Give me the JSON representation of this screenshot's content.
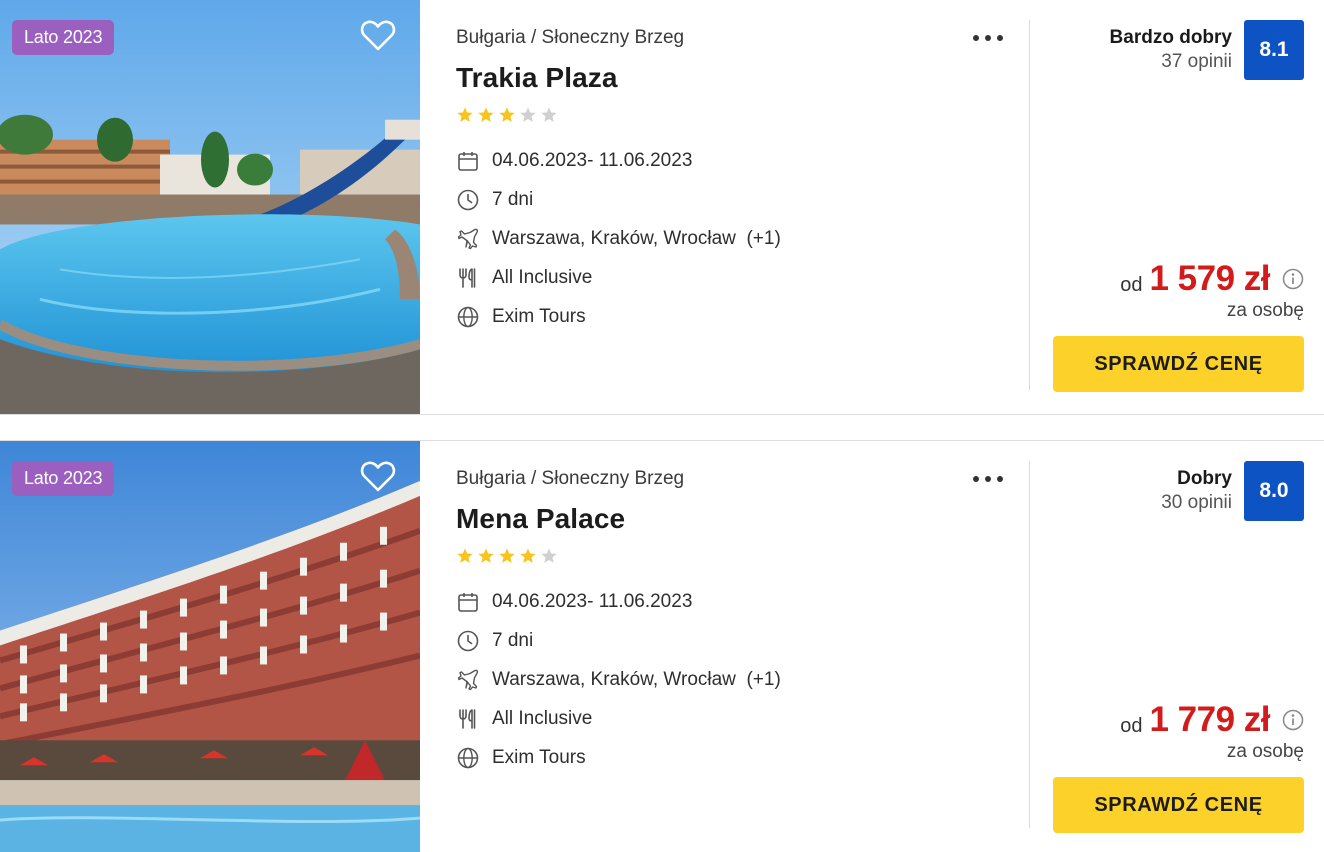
{
  "offers": [
    {
      "season_badge": "Lato 2023",
      "location": "Bułgaria / Słoneczny Brzeg",
      "hotel_name": "Trakia Plaza",
      "stars": 3,
      "features": {
        "dates": "04.06.2023- 11.06.2023",
        "duration": "7 dni",
        "departure": "Warszawa, Kraków, Wrocław  (+1)",
        "board": "All Inclusive",
        "operator": "Exim Tours"
      },
      "rating": {
        "label": "Bardzo dobry",
        "reviews": "37 opinii",
        "score": "8.1"
      },
      "price": {
        "prefix": "od",
        "value": "1 579 zł",
        "per_person": "za osobę"
      },
      "button_label": "SPRAWDŹ CENĘ"
    },
    {
      "season_badge": "Lato 2023",
      "location": "Bułgaria / Słoneczny Brzeg",
      "hotel_name": "Mena Palace",
      "stars": 4,
      "features": {
        "dates": "04.06.2023- 11.06.2023",
        "duration": "7 dni",
        "departure": "Warszawa, Kraków, Wrocław  (+1)",
        "board": "All Inclusive",
        "operator": "Exim Tours"
      },
      "rating": {
        "label": "Dobry",
        "reviews": "30 opinii",
        "score": "8.0"
      },
      "price": {
        "prefix": "od",
        "value": "1 779 zł",
        "per_person": "za osobę"
      },
      "button_label": "SPRAWDŹ CENĘ"
    }
  ],
  "icons": {
    "favorite": "heart-outline-icon",
    "more": "more-dots-icon",
    "star": "star-icon",
    "dates": "calendar-icon",
    "duration": "clock-icon",
    "departure": "plane-icon",
    "board": "cutlery-icon",
    "operator": "globe-icon",
    "price_info": "info-icon"
  },
  "colors": {
    "badge": "#9b5fc0",
    "score": "#0e53c4",
    "price": "#d21c1c",
    "button": "#fcd22a",
    "star_on": "#f8c41b",
    "star_off": "#d0d0d0"
  }
}
